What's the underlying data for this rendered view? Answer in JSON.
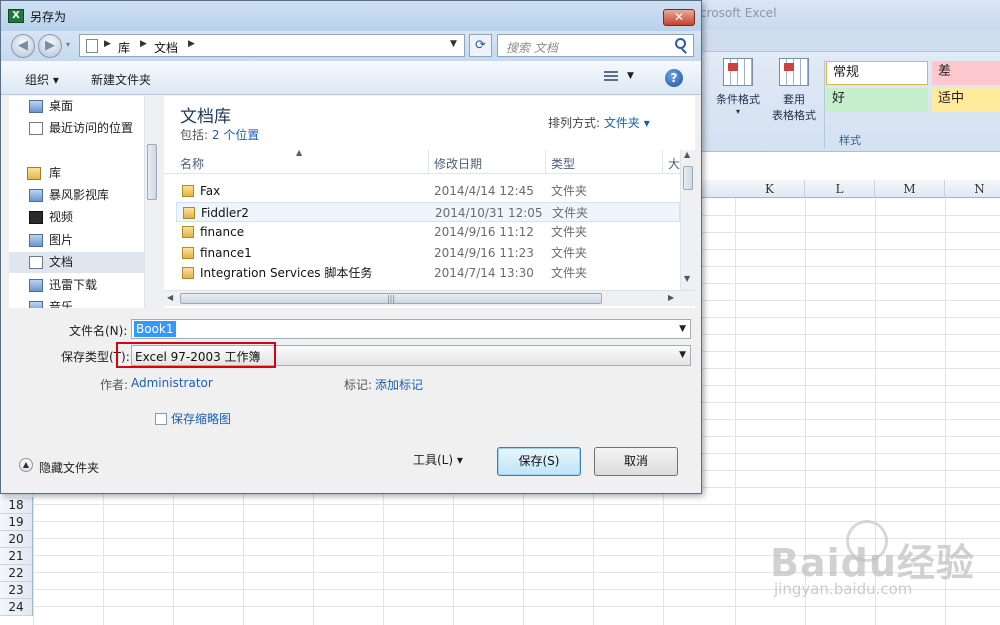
{
  "excel": {
    "title": "crosoft Excel",
    "ribbon": {
      "cond_format_label": "条件格式",
      "table_format_label_1": "套用",
      "table_format_label_2": "表格格式",
      "styles": [
        {
          "label": "常规",
          "bg": "#ffffff"
        },
        {
          "label": "差",
          "bg": "#ffc7ce"
        },
        {
          "label": "好",
          "bg": "#c6efce"
        },
        {
          "label": "适中",
          "bg": "#ffeb9c"
        }
      ],
      "group_label": "样式"
    },
    "columns": [
      "K",
      "L",
      "M",
      "N"
    ],
    "rows": [
      "18",
      "19",
      "20",
      "21",
      "22",
      "23",
      "24"
    ]
  },
  "dialog": {
    "title": "另存为",
    "close_glyph": "✕",
    "app_icon_glyph": "X",
    "address": {
      "segments": [
        "库",
        "文档"
      ],
      "search_placeholder": "搜索 文档"
    },
    "toolbar": {
      "organize": "组织 ▾",
      "new_folder": "新建文件夹",
      "help_glyph": "?"
    },
    "nav": [
      {
        "label": "桌面",
        "icon": "desktop-icon"
      },
      {
        "label": "最近访问的位置",
        "icon": "recent-places-icon"
      },
      {
        "label": "库",
        "icon": "library-icon"
      },
      {
        "label": "暴风影视库",
        "icon": "video-library-icon"
      },
      {
        "label": "视频",
        "icon": "videos-icon"
      },
      {
        "label": "图片",
        "icon": "pictures-icon"
      },
      {
        "label": "文档",
        "icon": "documents-icon"
      },
      {
        "label": "迅雷下载",
        "icon": "download-icon"
      },
      {
        "label": "音乐",
        "icon": "music-icon"
      }
    ],
    "library": {
      "title": "文档库",
      "includes_label": "包括:",
      "includes_value": "2 个位置",
      "arrange_label": "排列方式:",
      "arrange_value": "文件夹 ▾"
    },
    "columns": [
      "名称",
      "修改日期",
      "类型",
      "大"
    ],
    "files": [
      {
        "name": "Fax",
        "date": "2014/4/14 12:45",
        "type": "文件夹"
      },
      {
        "name": "Fiddler2",
        "date": "2014/10/31 12:05",
        "type": "文件夹"
      },
      {
        "name": "finance",
        "date": "2014/9/16 11:12",
        "type": "文件夹"
      },
      {
        "name": "finance1",
        "date": "2014/9/16 11:23",
        "type": "文件夹"
      },
      {
        "name": "Integration Services 脚本任务",
        "date": "2014/7/14 13:30",
        "type": "文件夹"
      }
    ],
    "form": {
      "filename_label": "文件名(N):",
      "filename_value": "Book1",
      "filetype_label": "保存类型(T):",
      "filetype_value": "Excel 97-2003 工作簿",
      "author_label": "作者:",
      "author_value": "Administrator",
      "tags_label": "标记:",
      "tags_value": "添加标记",
      "thumbnail_label": "保存缩略图"
    },
    "footer": {
      "hide_folders": "隐藏文件夹",
      "tools": "工具(L)   ▾",
      "save": "保存(S)",
      "cancel": "取消"
    }
  },
  "watermark": {
    "main": "Baidu经验",
    "sub": "jingyan.baidu.com"
  }
}
